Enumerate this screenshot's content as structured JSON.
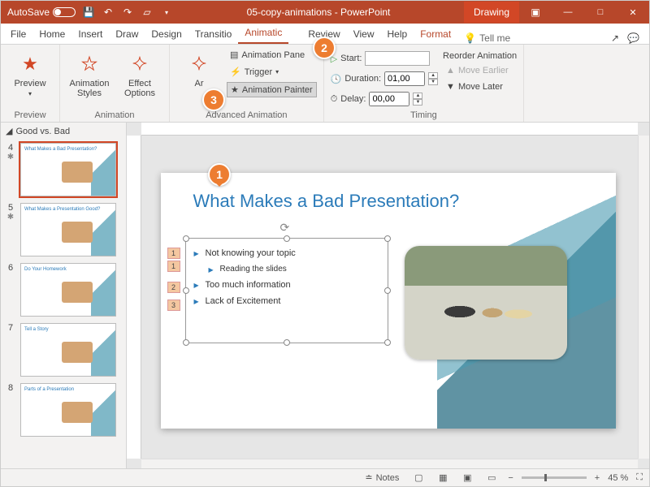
{
  "titlebar": {
    "autosave": "AutoSave",
    "doc": "05-copy-animations - PowerPoint",
    "mode": "Drawing"
  },
  "tabs": [
    "File",
    "Home",
    "Insert",
    "Draw",
    "Design",
    "Transitio",
    "Animatic",
    "",
    "Review",
    "View",
    "Help",
    "Format"
  ],
  "tellme": "Tell me",
  "ribbon": {
    "preview": {
      "label": "Preview",
      "group": "Preview"
    },
    "animation": {
      "styles": "Animation Styles",
      "effect": "Effect Options",
      "group": "Animation"
    },
    "advanced": {
      "add": "Ar",
      "pane": "Animation Pane",
      "trigger": "Trigger",
      "painter": "Animation Painter",
      "group": "Advanced Animation"
    },
    "timing": {
      "start": "Start:",
      "duration": "Duration:",
      "delay": "Delay:",
      "duration_val": "01,00",
      "delay_val": "00,00",
      "reorder": "Reorder Animation",
      "earlier": "Move Earlier",
      "later": "Move Later",
      "group": "Timing"
    }
  },
  "section": "Good vs. Bad",
  "thumbs": [
    {
      "n": "4",
      "title": "What Makes a Bad Presentation?",
      "star": true,
      "active": true
    },
    {
      "n": "5",
      "title": "What Makes a Presentation Good?",
      "star": true
    },
    {
      "n": "6",
      "title": "Do Your Homework",
      "star": false
    },
    {
      "n": "7",
      "title": "Tell a Story",
      "star": false
    },
    {
      "n": "8",
      "title": "Parts of a Presentation",
      "star": false
    }
  ],
  "slide": {
    "title": "What Makes a Bad Presentation?",
    "bullets": [
      "Not knowing your topic",
      "Reading the slides",
      "Too much information",
      "Lack of Excitement"
    ],
    "anim_tags": [
      "1",
      "1",
      "2",
      "3"
    ]
  },
  "status": {
    "notes": "Notes",
    "zoom": "45 %"
  },
  "callouts": {
    "c1": "1",
    "c2": "2",
    "c3": "3"
  }
}
